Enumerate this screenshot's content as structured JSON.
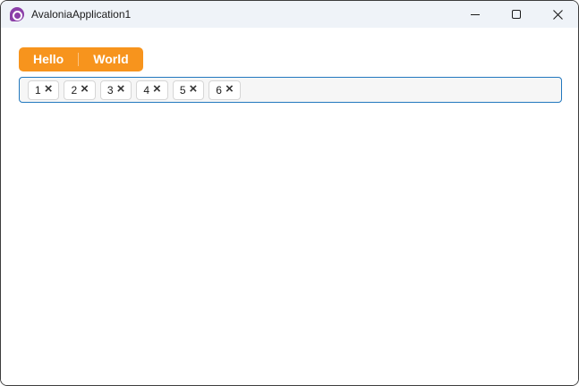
{
  "window": {
    "title": "AvaloniaApplication1",
    "controls": [
      "minimize",
      "maximize",
      "close"
    ]
  },
  "toolbar": {
    "buttons": [
      {
        "label": "Hello"
      },
      {
        "label": "World"
      }
    ]
  },
  "chips": {
    "remove_icon": "×",
    "items": [
      {
        "label": "1"
      },
      {
        "label": "2"
      },
      {
        "label": "3"
      },
      {
        "label": "4"
      },
      {
        "label": "5"
      },
      {
        "label": "6"
      }
    ]
  },
  "colors": {
    "accent_orange": "#F7941D",
    "focus_border_blue": "#2278BE",
    "titlebar_bg": "#EFF3F8",
    "logo_purple": "#8B3FA8",
    "window_border": "#3D3D3D"
  }
}
